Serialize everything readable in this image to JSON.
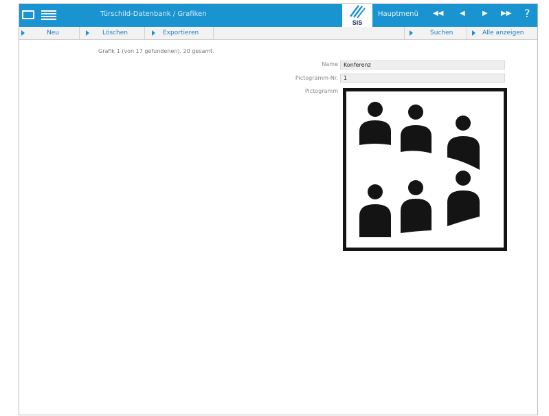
{
  "titlebar": {
    "title": "Türschild-Datenbank / Grafiken",
    "logo_text": "SIS",
    "main_menu": "Hauptmenü",
    "nav": {
      "first": "◀◀",
      "prev": "◀",
      "next": "▶",
      "last": "▶▶"
    },
    "help": "?"
  },
  "toolbar": {
    "new": "Neu",
    "delete": "Löschen",
    "export": "Exportieren",
    "search": "Suchen",
    "show_all": "Alle anzeigen"
  },
  "record": {
    "status": "Grafik 1 (von 17 gefundenen). 20 gesamt.",
    "name_label": "Name",
    "name_value": "Konferenz",
    "number_label": "Pictogramm-Nr.",
    "number_value": "1",
    "pictogram_label": "Pictogramm"
  },
  "colors": {
    "accent": "#1a93d1",
    "pictogram": "#141414"
  },
  "icons": [
    "form-view-icon",
    "list-view-icon",
    "sis-logo",
    "conference-pictogram"
  ]
}
